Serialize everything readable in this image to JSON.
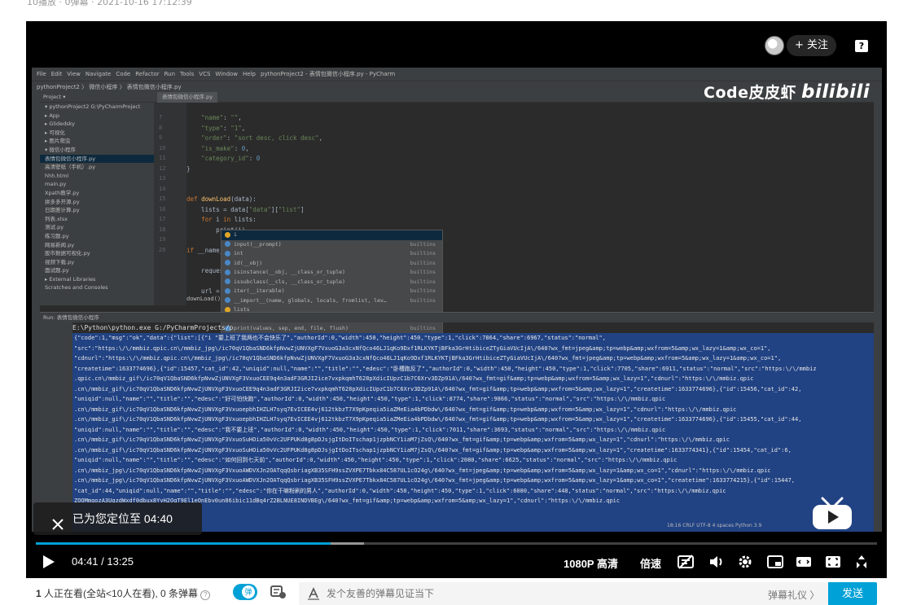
{
  "meta": {
    "text": "10播放 · 0弹幕 · 2021-10-16 17:12:39"
  },
  "player": {
    "follow_label": "+ 关注",
    "help_glyph": "?",
    "toast": "已为您定位至 04:40",
    "time_current": "04:41",
    "time_total": "13:25",
    "time_sep": " / ",
    "progress": 0.3503,
    "buffered": 0.39,
    "quality": "1080P 高清",
    "speed": "倍速",
    "accent": "#00a1d6"
  },
  "watermark": {
    "text": "Code皮皮虾",
    "brand": "bilibili"
  },
  "ide": {
    "menu": [
      "File",
      "Edit",
      "View",
      "Navigate",
      "Code",
      "Refactor",
      "Run",
      "Tools",
      "VCS",
      "Window",
      "Help",
      "pythonProject2 - 表情包微信小程序.py - PyCharm"
    ],
    "breadcrumb": "pythonProject2 〉 微信小程序 〉 表情包微信小程序.py",
    "project_header": "Project ▾",
    "tree": [
      "▾ pythonProject2  G:\\PyCharmProject",
      "  ▸ App",
      "  ▸ Glidedsky",
      "  ▸ 可视化",
      "  ▸ 图片爬虫",
      "  ▾ 微信小程序",
      "      表情包微信小程序.py",
      "      高清壁纸（手机）.py",
      "    hhh.html",
      "    main.py",
      "    Xpath教学.py",
      "    拼多多开源.py",
      "    日期差计算.py",
      "    列表.xlsx",
      "    测试.py",
      "    练习题.py",
      "    网易新闻.py",
      "    股市数据可视化.py",
      "    视频下载.py",
      "    面试题.py",
      "▸ External Libraries",
      "  Scratches and Consoles"
    ],
    "tab_label": "表情包微信小程序.py",
    "code_lines": [
      {
        "n": "7",
        "t": "    \"name\": \"\","
      },
      {
        "n": "8",
        "t": "    \"type\": \"1\","
      },
      {
        "n": "9",
        "t": "    \"order\": \"sort desc, click desc\","
      },
      {
        "n": "10",
        "t": "    \"is_make\": 0,"
      },
      {
        "n": "11",
        "t": "    \"category_id\": 0"
      },
      {
        "n": "12",
        "t": "}"
      },
      {
        "n": "13",
        "t": ""
      },
      {
        "n": "14",
        "t": ""
      },
      {
        "n": "15",
        "t": "def downLoad(data):"
      },
      {
        "n": "16",
        "t": "    lists = data[\"data\"][\"list\"]"
      },
      {
        "n": "17",
        "t": "    for i in lists:"
      },
      {
        "n": "18",
        "t": "        print(i)"
      },
      {
        "n": "19",
        "t": ""
      },
      {
        "n": "20",
        "t": "if __name__"
      },
      {
        "n": "",
        "t": ""
      },
      {
        "n": "",
        "t": "    request"
      },
      {
        "n": "",
        "t": ""
      },
      {
        "n": "",
        "t": "    url ="
      }
    ],
    "fn_crumb": "downLoad()",
    "autocomplete": [
      {
        "name": "i",
        "src": ""
      },
      {
        "name": "input(__prompt)",
        "src": "builtins"
      },
      {
        "name": "int",
        "src": "builtins"
      },
      {
        "name": "id(__obj)",
        "src": "builtins"
      },
      {
        "name": "isinstance(__obj, __class_or_tuple)",
        "src": "builtins"
      },
      {
        "name": "issubclass(__cls, __class_or_tuple)",
        "src": "builtins"
      },
      {
        "name": "iter(__iterable)",
        "src": "builtins"
      },
      {
        "name": "__import__(name, globals, locals, fromlist, lev…",
        "src": "builtins"
      },
      {
        "name": "lists",
        "src": ""
      },
      {
        "name": "list",
        "src": "builtins"
      },
      {
        "name": "print(values, sep, end, file, flush)",
        "src": "builtins"
      }
    ],
    "run_header": "Run:   表情包微信小程序",
    "run_cmd": "E:\\Python\\python.exe G:/PyCharmProjects/p",
    "run_output": [
      "{\"code\":1,\"msg\":\"ok\",\"data\":{\"list\":[{\"i                                                 \"要上班了我两也不会快乐了\",\"authorId\":0,\"width\":450,\"height\":450,\"type\":1,\"click\":7864,\"share\":6967,\"status\":\"normal\",",
      "\"src\":\"https:\\/\\/mmbiz.qpic.cn\\/mmbiz_jpg\\/ic70qV1QbaSND6kfpNvwZjUNVXgF7VxuoG3a3cxNfQco46LJ1qKo9Dxf1RLKYKTjBFka3GrHtibiceZTyGiaVUcIjA\\/640?wx_fmt=jpeg&amp;tp=webp&amp;wxfrom=5&amp;wx_lazy=1&amp;wx_co=1\",",
      "\"cdnurl\":\"https:\\/\\/mmbiz.qpic.cn\\/mmbiz_jpg\\/ic70qV1QbaSND6kfpNvwZjUNVXgF7VxuoG3a3cxNfQco46LJ1qKo9Dxf1RLKYKTjBFka3GrHtibiceZTyGiaVUcIjA\\/640?wx_fmt=jpeg&amp;tp=webp&amp;wxfrom=5&amp;wx_lazy=1&amp;wx_co=1\",",
      "\"createtime\":1633774696},{\"id\":15457,\"cat_id\":42,\"uniqid\":null,\"name\":\"\",\"title\":\"\",\"edesc\":\"卧槽跑反了\",\"authorId\":0,\"width\":450,\"height\":450,\"type\":1,\"click\":7705,\"share\":6911,\"status\":\"normal\",\"src\":\"https:\\/\\/mmbiz",
      ".qpic.cn\\/mmbiz_gif\\/ic70qV1QbaSND6kfpNvwZjUNVXgF3VxuoCEE9q4n3adF3GRJI2ice7vxpkqmhT628pXdicIUpzC1b7C6Xrv3DZp91A\\/640?wx_fmt=gif&amp;tp=webp&amp;wxfrom=5&amp;wx_lazy=1\",\"cdnurl\":\"https:\\/\\/mmbiz.qpic",
      ".cn\\/mmbiz_gif\\/ic70qV1QbaSND6kfpNvwZjUNVXgF3VxuoCEE9q4n3adF3GRJI2ice7vxpkqmhT628pXdicIUpzC1b7C6Xrv3DZp91A\\/640?wx_fmt=gif&amp;tp=webp&amp;wxfrom=5&amp;wx_lazy=1\",\"createtime\":1633774696},{\"id\":15456,\"cat_id\":42,",
      "\"uniqid\":null,\"name\":\"\",\"title\":\"\",\"edesc\":\"好可怕快跑\",\"authorId\":0,\"width\":450,\"height\":450,\"type\":1,\"click\":8774,\"share\":9866,\"status\":\"normal\",\"src\":\"https:\\/\\/mmbiz.qpic",
      ".cn\\/mmbiz_gif\\/ic70qV1QbaSND6kfpNvwZjUNVXgF3VxuoepbhIHZLH7syq7EvICEE4vj612tkbzT7X9pKpeqia5iaZMeEia4bPDbdw\\/640?wx_fmt=gif&amp;tp=webp&amp;wxfrom=5&amp;wx_lazy=1\",\"cdnurl\":\"https:\\/\\/mmbiz.qpic",
      ".cn\\/mmbiz_gif\\/ic70qV1QbaSND6kfpNvwZjUNVXgF3VxuoepbhIHZLH7syq7EvICEE4vj612tkbzT7X9pKpeqia5iaZMeEia4bPDbdw\\/640?wx_fmt=gif&amp;tp=webp&amp;wxfrom=5&amp;wx_lazy=1\",\"createtime\":1633774696},{\"id\":15455,\"cat_id\":44,",
      "\"uniqid\":null,\"name\":\"\",\"title\":\"\",\"edesc\":\"我不要上班\",\"authorId\":0,\"width\":450,\"height\":450,\"type\":1,\"click\":7011,\"share\":3693,\"status\":\"normal\",\"src\":\"https:\\/\\/mmbiz.qpic",
      ".cn\\/mmbiz_gif\\/ic70qV1QbaSND6kfpNvwZjUNVXgF3VxuoSuHOia50vVc2UFPUKd8g8pDJsjgItDoITschap1jzpbNCY1iaM7jZsQ\\/640?wx_fmt=gif&amp;tp=webp&amp;wxfrom=5&amp;wx_lazy=1\",\"cdnurl\":\"https:\\/\\/mmbiz.qpic",
      ".cn\\/mmbiz_gif\\/ic70qV1QbaSND6kfpNvwZjUNVXgF3VxuoSuHOia50vVc2UFPUKd8g8pDJsjgItDoITschap1jzpbNCY1iaM7jZsQ\\/640?wx_fmt=gif&amp;tp=webp&amp;wxfrom=5&amp;wx_lazy=1\",\"createtime\":1633774341},{\"id\":15454,\"cat_id\":6,",
      "\"uniqid\":null,\"name\":\"\",\"title\":\"\",\"edesc\":\"如何回到七天前\",\"authorId\":0,\"width\":450,\"height\":450,\"type\":1,\"click\":2080,\"share\":6625,\"status\":\"normal\",\"src\":\"https:\\/\\/mmbiz.qpic",
      ".cn\\/mmbiz_jpg\\/ic70qV1QbaSND6kfpNvwZjUNVXgF3VxuoAWDVXJn2OATqqQsbriagXB35SFH9ssZVXPE7Tbkx84C587UL1cO24g\\/640?wx_fmt=jpeg&amp;tp=webp&amp;wxfrom=5&amp;wx_lazy=1&amp;wx_co=1\",\"cdnurl\":\"https:\\/\\/mmbiz.qpic",
      ".cn\\/mmbiz_jpg\\/ic70qV1QbaSND6kfpNvwZjUNVXgF3VxuoAWDVXJn2OATqqQsbriagXB35SFH9ssZVXPE7Tbkx84C587UL1cO24g\\/640?wx_fmt=jpeg&amp;tp=webp&amp;wxfrom=5&amp;wx_lazy=1&amp;wx_co=1\",\"createtime\":1633774215},{\"id\":15447,",
      "\"cat_id\":44,\"uniqid\":null,\"name\":\"\",\"title\":\"\",\"edesc\":\"你在干嘛粉刷的男人\",\"authorId\":0,\"width\":450,\"height\":450,\"type\":1,\"click\":6080,\"share\":448,\"status\":\"normal\",\"src\":\"https:\\/\\/mmbiz.qpic",
      "                    ZOOMmqozA3UgzdWxdf0dbux8YyH2OqT9El1eOnEbv0un86ibic11dBq4rZ2BLNUE8INDVBEg\\/640?wx_fmt=gif&amp;tp=webp&amp;wxfrom=5&amp;wx_lazy=1\",\"cdnurl\":\"https:\\/\\/mmbiz.qpic"
    ],
    "status": "18:16   CRLF   UTF-8   4 spaces   Python 3.9"
  },
  "bottom": {
    "viewers_count": "1",
    "viewers_text": " 人正在看(全站<10人在看), 0 条弹幕",
    "dm_toggle_label": "弹",
    "dm_placeholder": "发个友善的弹幕见证当下",
    "dm_etiquette": "弹幕礼仪 〉",
    "dm_send": "发送"
  }
}
